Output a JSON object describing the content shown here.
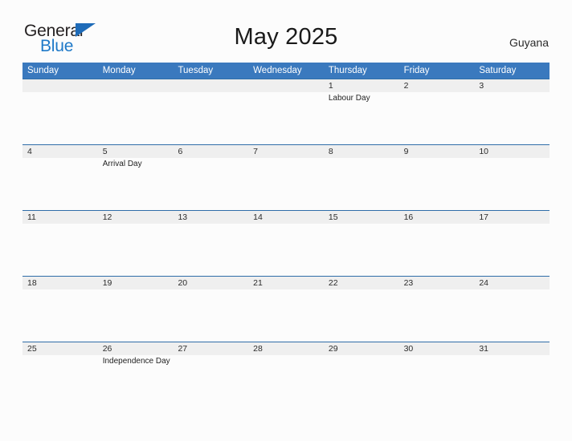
{
  "brand": {
    "word_one": "General",
    "word_two": "Blue",
    "triangle_icon": "triangle-icon",
    "color_dark": "#231F20",
    "color_blue": "#1E79C8"
  },
  "header": {
    "title": "May 2025",
    "country": "Guyana"
  },
  "theme": {
    "header_blue": "#3A79BE",
    "row_line_blue": "#2F6DA8",
    "strip_gray": "#EFEFEF",
    "page_background": "#FCFCFC"
  },
  "calendar": {
    "weekdays": [
      "Sunday",
      "Monday",
      "Tuesday",
      "Wednesday",
      "Thursday",
      "Friday",
      "Saturday"
    ],
    "weeks": [
      [
        {
          "date": "",
          "event": ""
        },
        {
          "date": "",
          "event": ""
        },
        {
          "date": "",
          "event": ""
        },
        {
          "date": "",
          "event": ""
        },
        {
          "date": "1",
          "event": "Labour Day"
        },
        {
          "date": "2",
          "event": ""
        },
        {
          "date": "3",
          "event": ""
        }
      ],
      [
        {
          "date": "4",
          "event": ""
        },
        {
          "date": "5",
          "event": "Arrival Day"
        },
        {
          "date": "6",
          "event": ""
        },
        {
          "date": "7",
          "event": ""
        },
        {
          "date": "8",
          "event": ""
        },
        {
          "date": "9",
          "event": ""
        },
        {
          "date": "10",
          "event": ""
        }
      ],
      [
        {
          "date": "11",
          "event": ""
        },
        {
          "date": "12",
          "event": ""
        },
        {
          "date": "13",
          "event": ""
        },
        {
          "date": "14",
          "event": ""
        },
        {
          "date": "15",
          "event": ""
        },
        {
          "date": "16",
          "event": ""
        },
        {
          "date": "17",
          "event": ""
        }
      ],
      [
        {
          "date": "18",
          "event": ""
        },
        {
          "date": "19",
          "event": ""
        },
        {
          "date": "20",
          "event": ""
        },
        {
          "date": "21",
          "event": ""
        },
        {
          "date": "22",
          "event": ""
        },
        {
          "date": "23",
          "event": ""
        },
        {
          "date": "24",
          "event": ""
        }
      ],
      [
        {
          "date": "25",
          "event": ""
        },
        {
          "date": "26",
          "event": "Independence Day"
        },
        {
          "date": "27",
          "event": ""
        },
        {
          "date": "28",
          "event": ""
        },
        {
          "date": "29",
          "event": ""
        },
        {
          "date": "30",
          "event": ""
        },
        {
          "date": "31",
          "event": ""
        }
      ]
    ]
  }
}
